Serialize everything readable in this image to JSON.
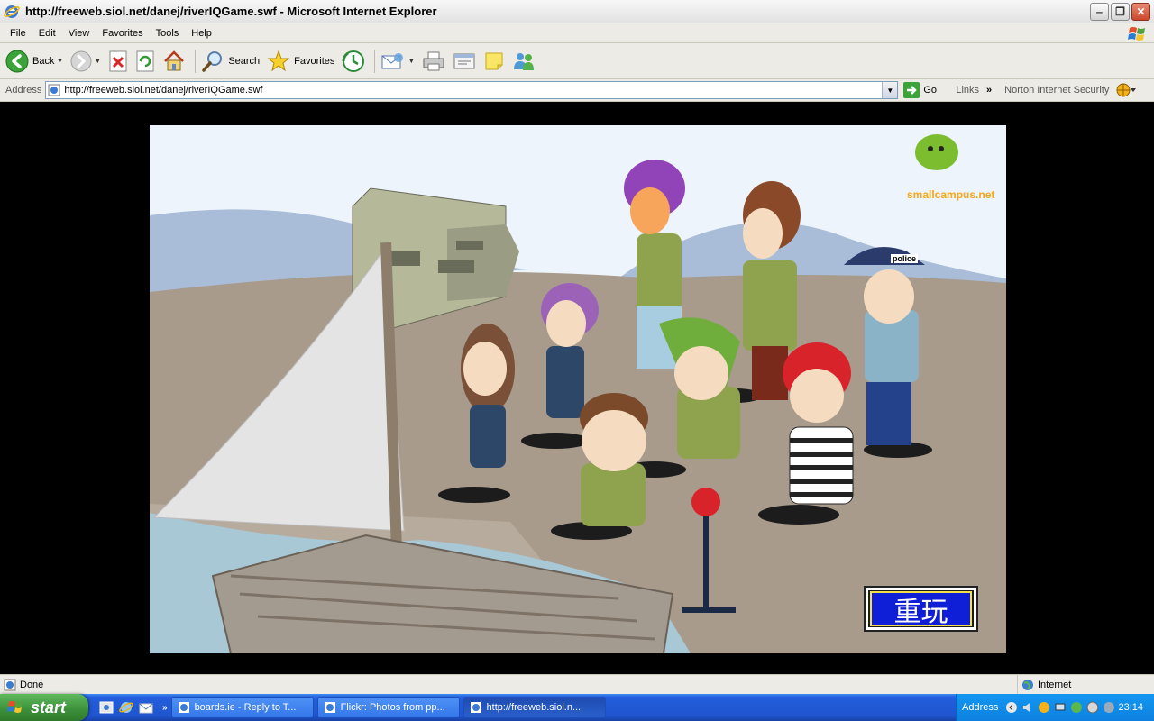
{
  "window": {
    "title": "http://freeweb.siol.net/danej/riverIQGame.swf - Microsoft Internet Explorer",
    "icon": "ie-icon"
  },
  "menu": [
    "File",
    "Edit",
    "View",
    "Favorites",
    "Tools",
    "Help"
  ],
  "toolbar": {
    "back_label": "Back",
    "search_label": "Search",
    "favorites_label": "Favorites"
  },
  "address": {
    "label": "Address",
    "url": "http://freeweb.siol.net/danej/riverIQGame.swf",
    "go_label": "Go",
    "links_label": "Links",
    "norton_label": "Norton Internet Security"
  },
  "game": {
    "logo_text": "smallcampus.net",
    "police_cap_text": "police",
    "replay_label": "重玩"
  },
  "status": {
    "text": "Done",
    "zone": "Internet"
  },
  "taskbar": {
    "start_label": "start",
    "tasks": [
      {
        "label": "boards.ie - Reply to T..."
      },
      {
        "label": "Flickr: Photos from pp..."
      },
      {
        "label": "http://freeweb.siol.n..."
      }
    ],
    "tray_address_label": "Address",
    "clock": "23:14"
  },
  "colors": {
    "xp_blue": "#245edb",
    "start_green": "#3c8f3a",
    "replay_blue": "#0f1fd8",
    "logo_orange": "#f4a81d"
  }
}
